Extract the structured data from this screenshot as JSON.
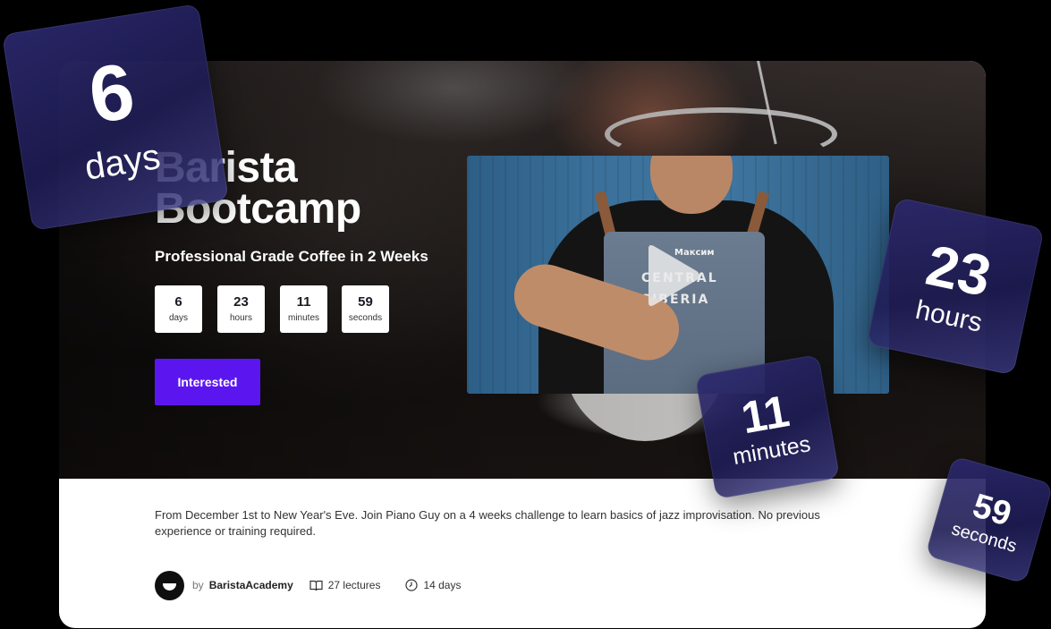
{
  "hero": {
    "title": "Barista Bootcamp",
    "subtitle": "Professional Grade Coffee in 2 Weeks",
    "button_label": "Interested"
  },
  "countdown": [
    {
      "value": "6",
      "unit": "days"
    },
    {
      "value": "23",
      "unit": "hours"
    },
    {
      "value": "11",
      "unit": "minutes"
    },
    {
      "value": "59",
      "unit": "seconds"
    }
  ],
  "video": {
    "apron_top": "Максим",
    "apron_line1": "CENTRAL",
    "apron_line2": "SIBERIA",
    "play_icon": "play-icon"
  },
  "description": "From December 1st to New Year's Eve. Join Piano Guy on a 4 weeks challenge to learn basics of jazz improvisation. No previous experience or training required.",
  "meta": {
    "by_label": "by",
    "author": "BaristaAcademy",
    "lectures": "27 lectures",
    "duration": "14 days",
    "lectures_icon": "book-icon",
    "duration_icon": "clock-icon"
  },
  "colors": {
    "accent": "#5b16f0",
    "tile": "#241f5e",
    "background": "#000000"
  }
}
